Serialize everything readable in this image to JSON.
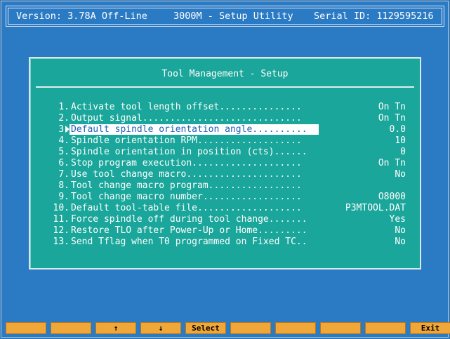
{
  "header": {
    "version": "Version: 3.78A Off-Line",
    "product": "3000M - Setup Utility",
    "serial": "Serial ID: 1129595216"
  },
  "panel": {
    "title": "Tool Management - Setup"
  },
  "menu": [
    {
      "num": "1.",
      "label": "Activate tool length offset...............",
      "value": "On Tn"
    },
    {
      "num": "2.",
      "label": "Output signal.............................",
      "value": "On Tn"
    },
    {
      "num": "3.",
      "label": "Default spindle orientation angle..........",
      "value": "0.0"
    },
    {
      "num": "4.",
      "label": "Spindle orientation RPM...................",
      "value": "10"
    },
    {
      "num": "5.",
      "label": "Spindle orientation in position (cts)......",
      "value": "0"
    },
    {
      "num": "6.",
      "label": "Stop program execution....................",
      "value": "On Tn"
    },
    {
      "num": "7.",
      "label": "Use tool change macro.....................",
      "value": "No"
    },
    {
      "num": "8.",
      "label": "Tool change macro program.................",
      "value": ""
    },
    {
      "num": "9.",
      "label": "Tool change macro number..................",
      "value": "O8000"
    },
    {
      "num": "10.",
      "label": "Default tool-table file...................",
      "value": "P3MTOOL.DAT"
    },
    {
      "num": "11.",
      "label": "Force spindle off during tool change.......",
      "value": "Yes"
    },
    {
      "num": "12.",
      "label": "Restore TLO after Power-Up or Home.........",
      "value": "No"
    },
    {
      "num": "13.",
      "label": "Send Tflag when T0 programmed on Fixed TC..",
      "value": "No"
    }
  ],
  "selected_index": 2,
  "fkeys": [
    "",
    "",
    "↑",
    "↓",
    "Select",
    "",
    "",
    "",
    "",
    "Exit"
  ]
}
